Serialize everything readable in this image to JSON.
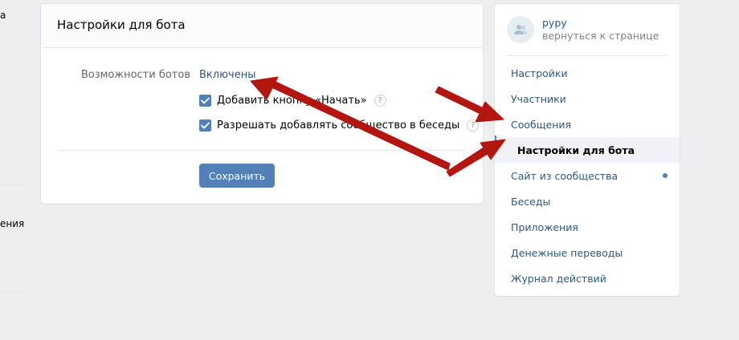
{
  "left_strip": {
    "text_top": "a",
    "text_bottom": "ения"
  },
  "card": {
    "title": "Настройки для бота",
    "bot_features_label": "Возможности ботов",
    "bot_features_value": "Включены",
    "checkbox_start_button": {
      "label": "Добавить кнопку «Начать»",
      "checked": true
    },
    "checkbox_allow_chats": {
      "label": "Разрешать добавлять сообщество в беседы",
      "checked": true
    },
    "help_symbol": "?",
    "save_label": "Сохранить"
  },
  "menu": {
    "group_name": "pypy",
    "back_label": "вернуться к странице",
    "items": [
      {
        "label": "Настройки"
      },
      {
        "label": "Участники"
      },
      {
        "label": "Сообщения"
      },
      {
        "label": "Настройки для бота",
        "active": true
      },
      {
        "label": "Сайт из сообщества",
        "has_dot": true
      },
      {
        "label": "Беседы"
      },
      {
        "label": "Приложения"
      },
      {
        "label": "Денежные переводы"
      },
      {
        "label": "Журнал действий"
      }
    ]
  },
  "colors": {
    "accent": "#5181b8",
    "link": "#2a5885",
    "arrow": "#b3150f",
    "background": "#edeef0"
  },
  "icons": {
    "checkbox": "checkmark-icon",
    "help": "question-icon",
    "avatar": "group-icon",
    "arrows": "annotation-arrow-icon"
  }
}
